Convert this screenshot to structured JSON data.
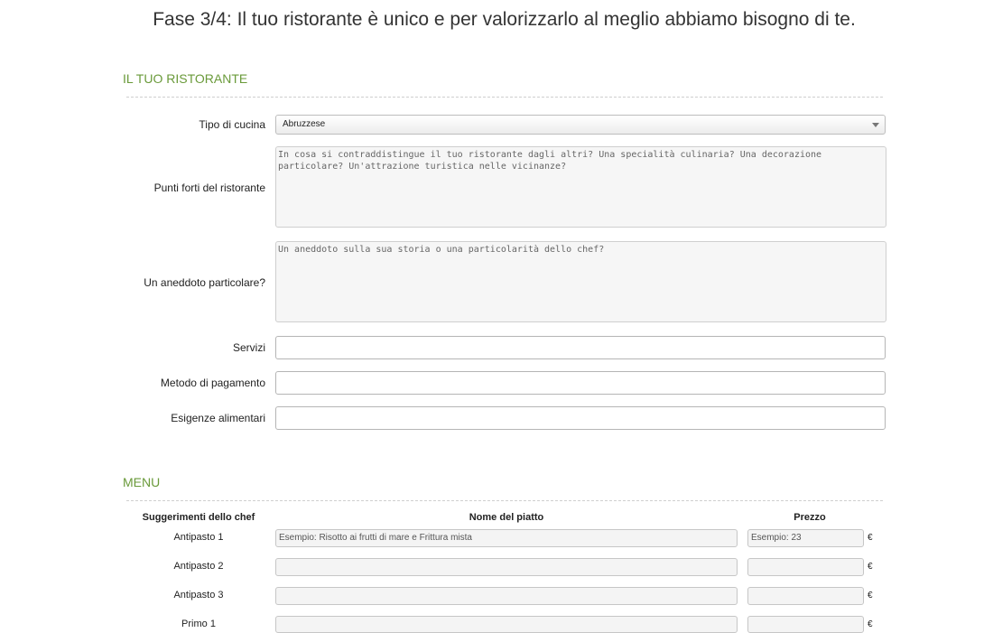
{
  "header": {
    "title": "Fase 3/4: Il tuo ristorante è unico e per valorizzarlo al meglio abbiamo bisogno di te."
  },
  "restaurant": {
    "heading": "IL TUO RISTORANTE",
    "fields": {
      "cuisine_label": "Tipo di cucina",
      "cuisine_value": "Abruzzese",
      "strengths_label": "Punti forti del ristorante",
      "strengths_placeholder": "In cosa si contraddistingue il tuo ristorante dagli altri? Una specialità culinaria? Una decorazione particolare? Un'attrazione turistica nelle vicinanze?",
      "anecdote_label": "Un aneddoto particolare?",
      "anecdote_placeholder": "Un aneddoto sulla sua storia o una particolarità dello chef?",
      "services_label": "Servizi",
      "services_value": "",
      "payment_label": "Metodo di pagamento",
      "payment_value": "",
      "dietary_label": "Esigenze alimentari",
      "dietary_value": ""
    }
  },
  "menu": {
    "heading": "MENU",
    "columns": {
      "suggestions": "Suggerimenti dello chef",
      "dish_name": "Nome del piatto",
      "price": "Prezzo"
    },
    "currency": "€",
    "rows": [
      {
        "label": "Antipasto 1",
        "dish_placeholder": "Esempio: Risotto ai frutti di mare e Frittura mista",
        "price_placeholder": "Esempio: 23"
      },
      {
        "label": "Antipasto 2",
        "dish_placeholder": "",
        "price_placeholder": ""
      },
      {
        "label": "Antipasto 3",
        "dish_placeholder": "",
        "price_placeholder": ""
      },
      {
        "label": "Primo 1",
        "dish_placeholder": "",
        "price_placeholder": ""
      }
    ]
  }
}
